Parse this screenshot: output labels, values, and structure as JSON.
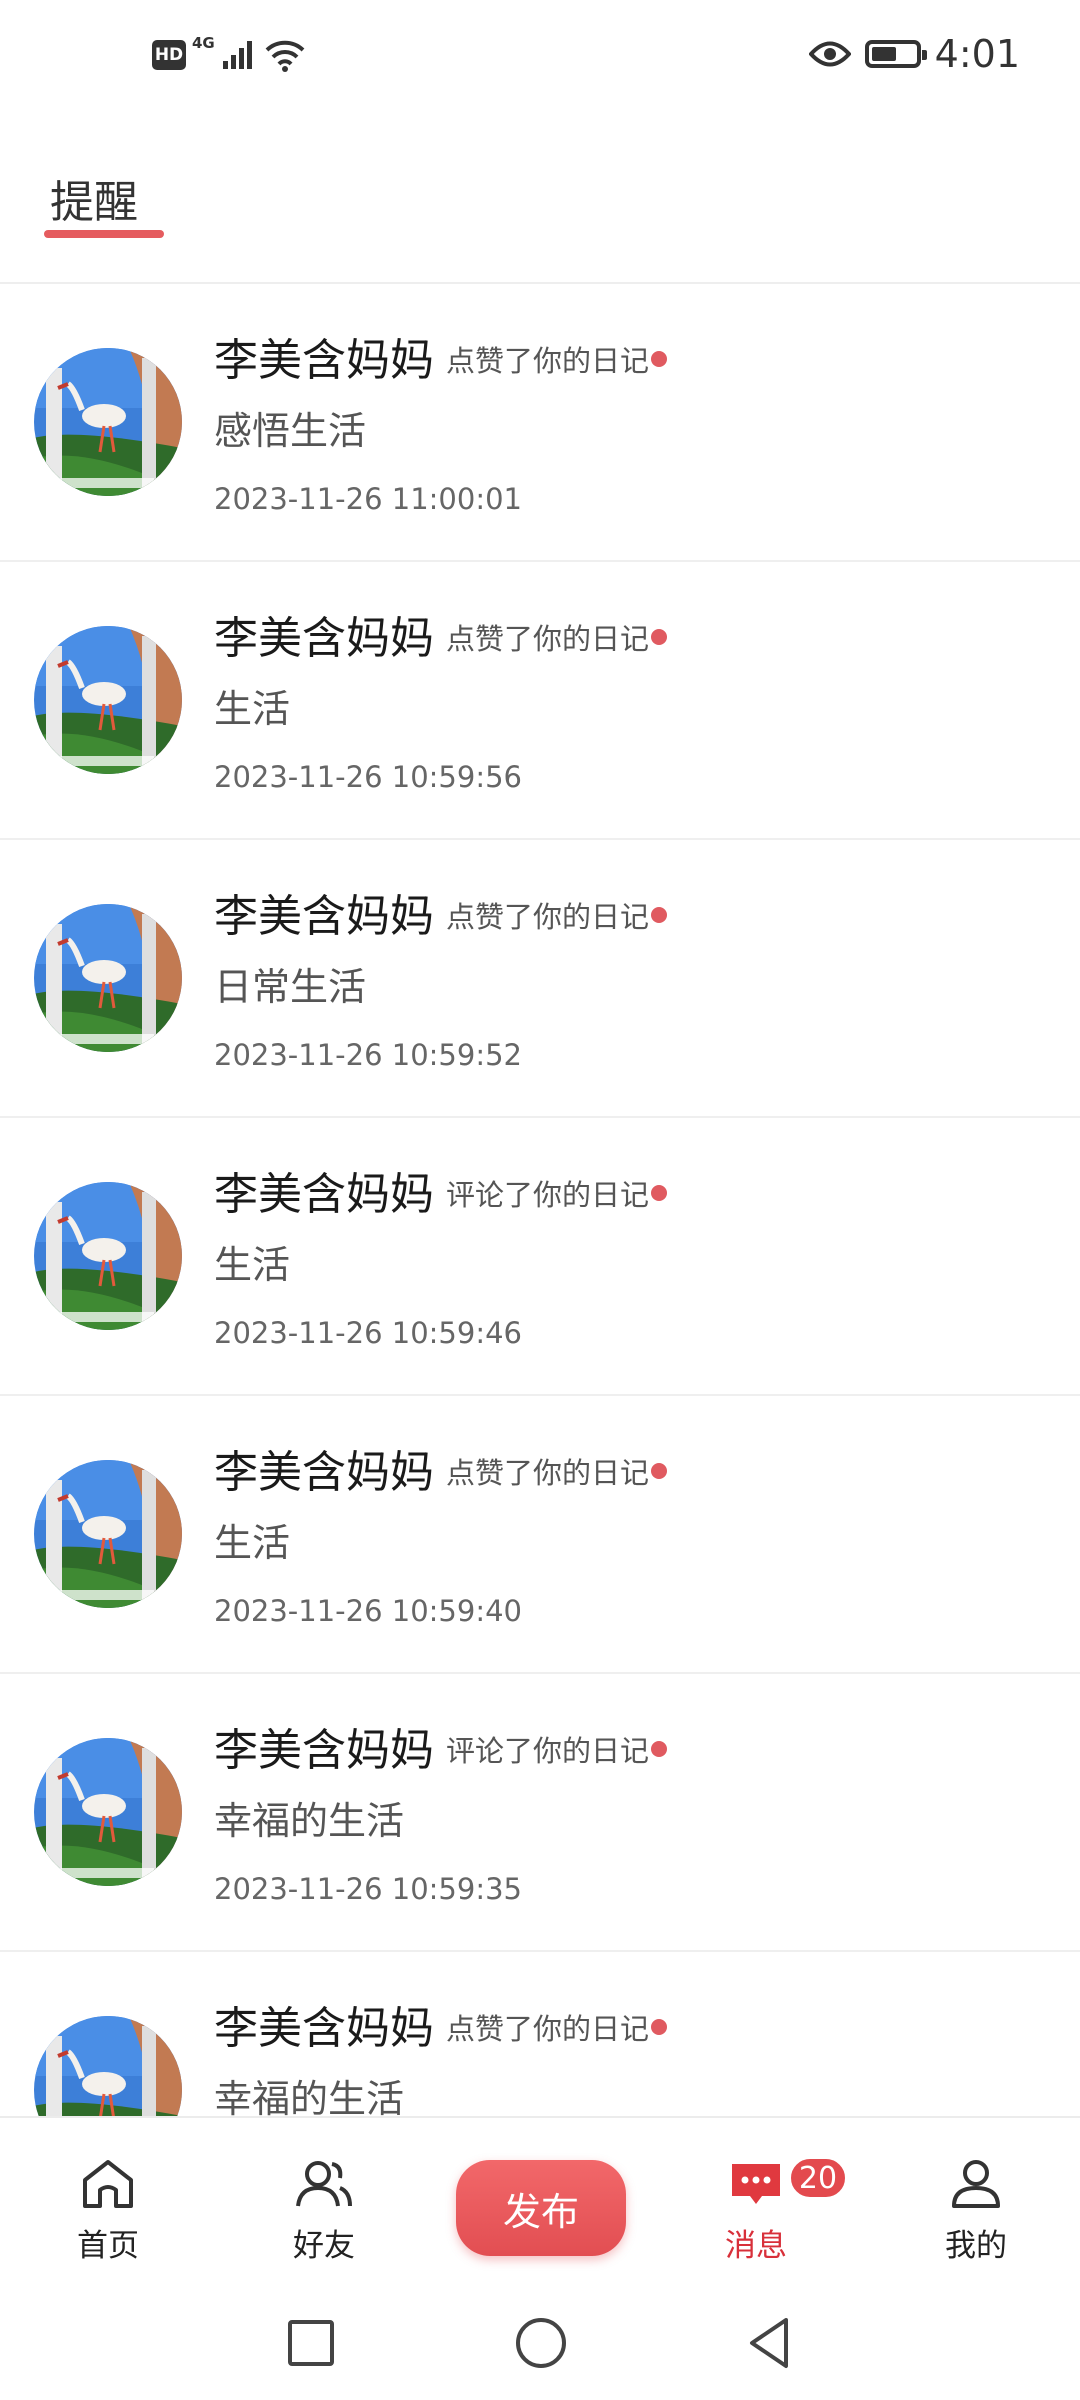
{
  "status_bar": {
    "hd": "HD",
    "network": "4G",
    "time": "4:01"
  },
  "header": {
    "tab_title": "提醒"
  },
  "notifications": [
    {
      "user": "李美含妈妈",
      "action": "点赞了你的日记",
      "content": "感悟生活",
      "time": "2023-11-26 11:00:01"
    },
    {
      "user": "李美含妈妈",
      "action": "点赞了你的日记",
      "content": "生活",
      "time": "2023-11-26 10:59:56"
    },
    {
      "user": "李美含妈妈",
      "action": "点赞了你的日记",
      "content": "日常生活",
      "time": "2023-11-26 10:59:52"
    },
    {
      "user": "李美含妈妈",
      "action": "评论了你的日记",
      "content": "生活",
      "time": "2023-11-26 10:59:46"
    },
    {
      "user": "李美含妈妈",
      "action": "点赞了你的日记",
      "content": "生活",
      "time": "2023-11-26 10:59:40"
    },
    {
      "user": "李美含妈妈",
      "action": "评论了你的日记",
      "content": "幸福的生活",
      "time": "2023-11-26 10:59:35"
    },
    {
      "user": "李美含妈妈",
      "action": "点赞了你的日记",
      "content": "幸福的生活",
      "time": ""
    }
  ],
  "bottom_nav": {
    "home": "首页",
    "friends": "好友",
    "publish": "发布",
    "messages": "消息",
    "messages_badge": "20",
    "mine": "我的"
  },
  "colors": {
    "accent": "#e55c5f",
    "unread_dot": "#e05a60",
    "active_nav": "#d8303a"
  }
}
